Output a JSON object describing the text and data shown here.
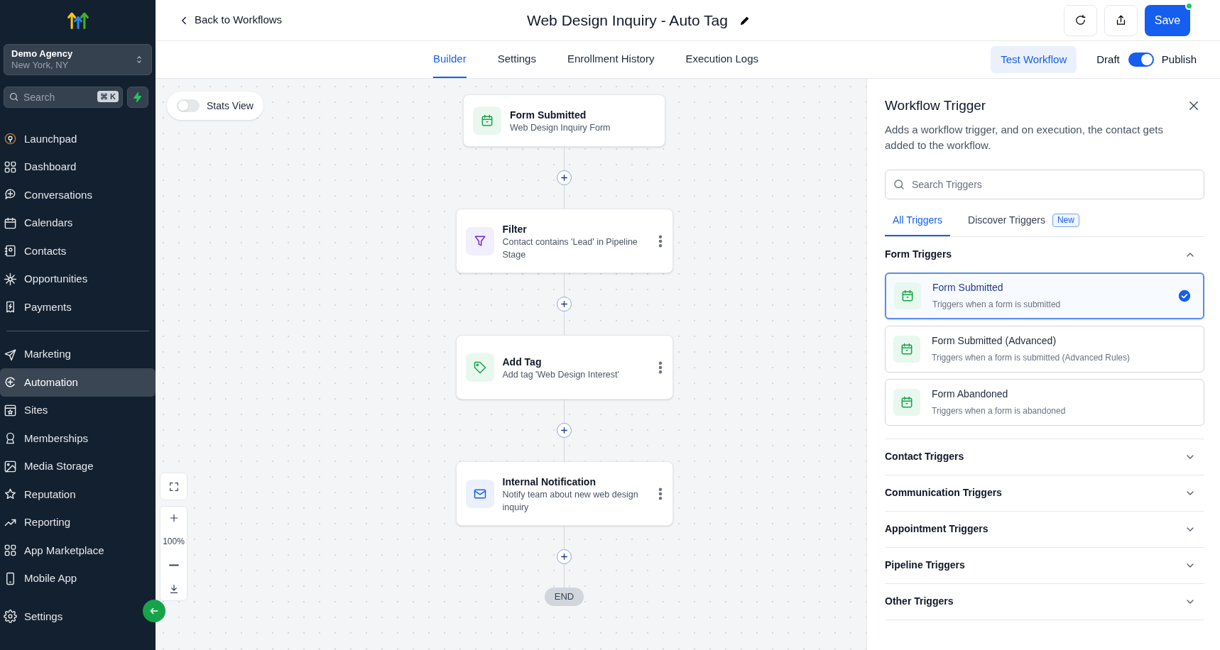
{
  "sidebar": {
    "account": {
      "name": "Demo Agency",
      "location": "New York, NY"
    },
    "search": {
      "placeholder": "Search",
      "shortcut": "⌘ K"
    },
    "nav_groups": [
      [
        {
          "label": "Launchpad",
          "selected": false
        },
        {
          "label": "Dashboard",
          "selected": false
        },
        {
          "label": "Conversations",
          "selected": false
        },
        {
          "label": "Calendars",
          "selected": false
        },
        {
          "label": "Contacts",
          "selected": false
        },
        {
          "label": "Opportunities",
          "selected": false
        },
        {
          "label": "Payments",
          "selected": false
        }
      ],
      [
        {
          "label": "Marketing",
          "selected": false
        },
        {
          "label": "Automation",
          "selected": true
        },
        {
          "label": "Sites",
          "selected": false
        },
        {
          "label": "Memberships",
          "selected": false
        },
        {
          "label": "Media Storage",
          "selected": false
        },
        {
          "label": "Reputation",
          "selected": false
        },
        {
          "label": "Reporting",
          "selected": false
        },
        {
          "label": "App Marketplace",
          "selected": false
        },
        {
          "label": "Mobile App",
          "selected": false
        }
      ]
    ],
    "footer_item": {
      "label": "Settings",
      "selected": false
    }
  },
  "header": {
    "back": "Back to Workflows",
    "title": "Web Design Inquiry - Auto Tag",
    "save": "Save",
    "save_notification": true
  },
  "tabs": [
    {
      "label": "Builder",
      "selected": true
    },
    {
      "label": "Settings",
      "selected": false
    },
    {
      "label": "Enrollment History",
      "selected": false
    },
    {
      "label": "Execution Logs",
      "selected": false
    }
  ],
  "test_button": "Test Workflow",
  "publish_toggle": {
    "off_label": "Draft",
    "on_label": "Publish",
    "on": true
  },
  "canvas": {
    "stats_view": {
      "label": "Stats View",
      "on": false
    },
    "nodes": [
      {
        "kind": "trigger",
        "title": "Form Submitted",
        "description": "Web Design Inquiry Form",
        "menu": false
      },
      {
        "kind": "filter",
        "title": "Filter",
        "description": "Contact contains 'Lead' in Pipeline Stage",
        "menu": true
      },
      {
        "kind": "tag",
        "title": "Add Tag",
        "description": "Add tag 'Web Design Interest'",
        "menu": true
      },
      {
        "kind": "email",
        "title": "Internal Notification",
        "description": "Notify team about new web design inquiry",
        "menu": true
      }
    ],
    "end_label": "END",
    "zoom_level": "100%"
  },
  "panel": {
    "title": "Workflow Trigger",
    "description": "Adds a workflow trigger, and on execution, the contact gets added to the workflow.",
    "search_placeholder": "Search Triggers",
    "tabs": [
      {
        "label": "All Triggers",
        "selected": true
      },
      {
        "label": "Discover Triggers",
        "selected": false,
        "badge": "New"
      }
    ],
    "sections": [
      {
        "title": "Form Triggers",
        "expanded": true,
        "items": [
          {
            "title": "Form Submitted",
            "description": "Triggers when a form is submitted",
            "selected": true
          },
          {
            "title": "Form Submitted (Advanced)",
            "description": "Triggers when a form is submitted (Advanced Rules)",
            "selected": false
          },
          {
            "title": "Form Abandoned",
            "description": "Triggers when a form is abandoned",
            "selected": false
          }
        ]
      },
      {
        "title": "Contact Triggers",
        "expanded": false
      },
      {
        "title": "Communication Triggers",
        "expanded": false
      },
      {
        "title": "Appointment Triggers",
        "expanded": false
      },
      {
        "title": "Pipeline Triggers",
        "expanded": false
      },
      {
        "title": "Other Triggers",
        "expanded": false
      }
    ]
  }
}
